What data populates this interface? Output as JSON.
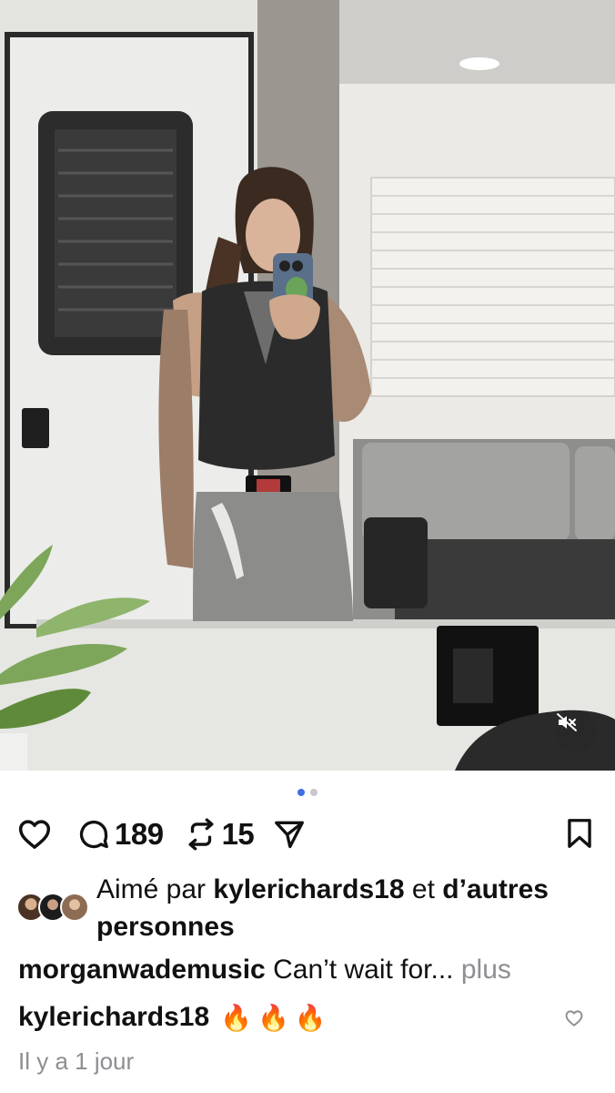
{
  "post": {
    "image_alt": "Mirror selfie in a trailer",
    "carousel": {
      "total": 2,
      "active": 1
    }
  },
  "actions": {
    "like_icon": "heart-icon",
    "comment_icon": "comment-bubble-icon",
    "comment_count": "189",
    "repost_icon": "repost-icon",
    "repost_count": "15",
    "share_icon": "send-icon",
    "save_icon": "bookmark-icon",
    "mute_icon": "speaker-muted-icon"
  },
  "likes": {
    "prefix": "Aimé par",
    "user": "kylerichards18",
    "connector": "et",
    "others": "d’autres personnes"
  },
  "caption": {
    "user": "morganwademusic",
    "text": "Can’t wait for...",
    "more": "plus"
  },
  "comment": {
    "user": "kylerichards18",
    "text": "🔥🔥🔥"
  },
  "timestamp": "Il y a 1 jour",
  "colors": {
    "accent_dot": "#3f6fe0",
    "muted_text": "#8e8e93",
    "primary_text": "#111111"
  }
}
